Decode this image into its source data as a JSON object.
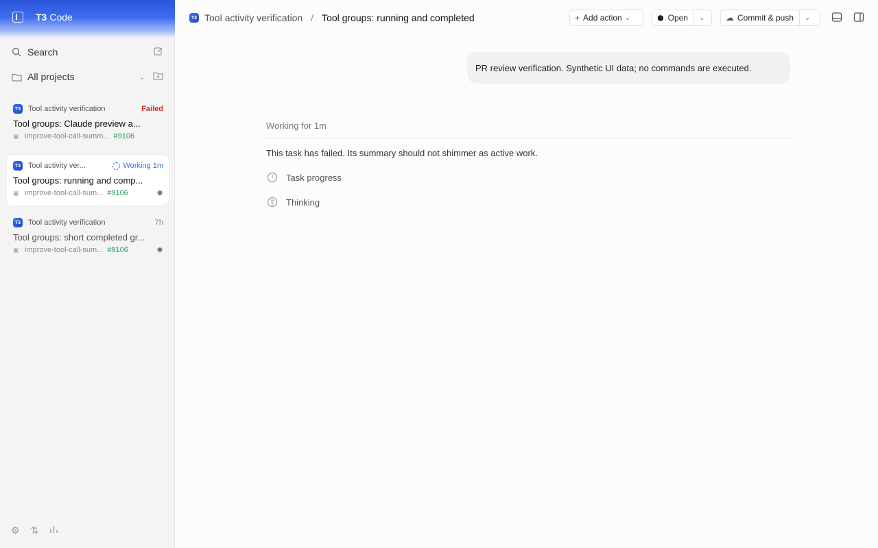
{
  "brand": {
    "logo_text": "T3",
    "name": "Code"
  },
  "sidebar": {
    "search_label": "Search",
    "projects_label": "All projects",
    "threads": [
      {
        "project": "Tool activity verification",
        "status": "Failed",
        "title": "Tool groups: Claude preview a...",
        "branch": "improve-tool-call-summ...",
        "pr": "#9106"
      },
      {
        "project": "Tool activity ver...",
        "status": "Working 1m",
        "title": "Tool groups: running and comp...",
        "branch": "improve-tool-call-sum...",
        "pr": "#9106"
      },
      {
        "project": "Tool activity verification",
        "status": "7h",
        "title": "Tool groups: short completed gr...",
        "branch": "improve-tool-call-sum...",
        "pr": "#9106"
      }
    ]
  },
  "header": {
    "project": "Tool activity verification",
    "separator": "/",
    "title": "Tool groups: running and completed",
    "add_action_label": "Add action",
    "open_label": "Open",
    "commit_label": "Commit & push"
  },
  "chat": {
    "user_message": "PR review verification. Synthetic UI data; no commands are executed.",
    "working_label": "Working for 1m",
    "assistant_text": "This task has failed. Its summary should not shimmer as active work.",
    "steps": [
      "Task progress",
      "Thinking"
    ]
  },
  "colors": {
    "accent": "#3c6df0",
    "failed": "#d22d2d",
    "working": "#2f74d8",
    "pr": "#1f9a55"
  },
  "icons": [
    "sidebar-toggle-icon",
    "search-icon",
    "compose-icon",
    "folder-icon",
    "chevron-down-icon",
    "add-folder-icon",
    "branch-icon",
    "agent-icon",
    "settings-icon",
    "sort-icon",
    "chart-icon",
    "plus-icon",
    "cube-icon",
    "cloud-upload-icon",
    "panel-bottom-icon",
    "panel-right-icon",
    "clock-icon",
    "brain-icon"
  ]
}
